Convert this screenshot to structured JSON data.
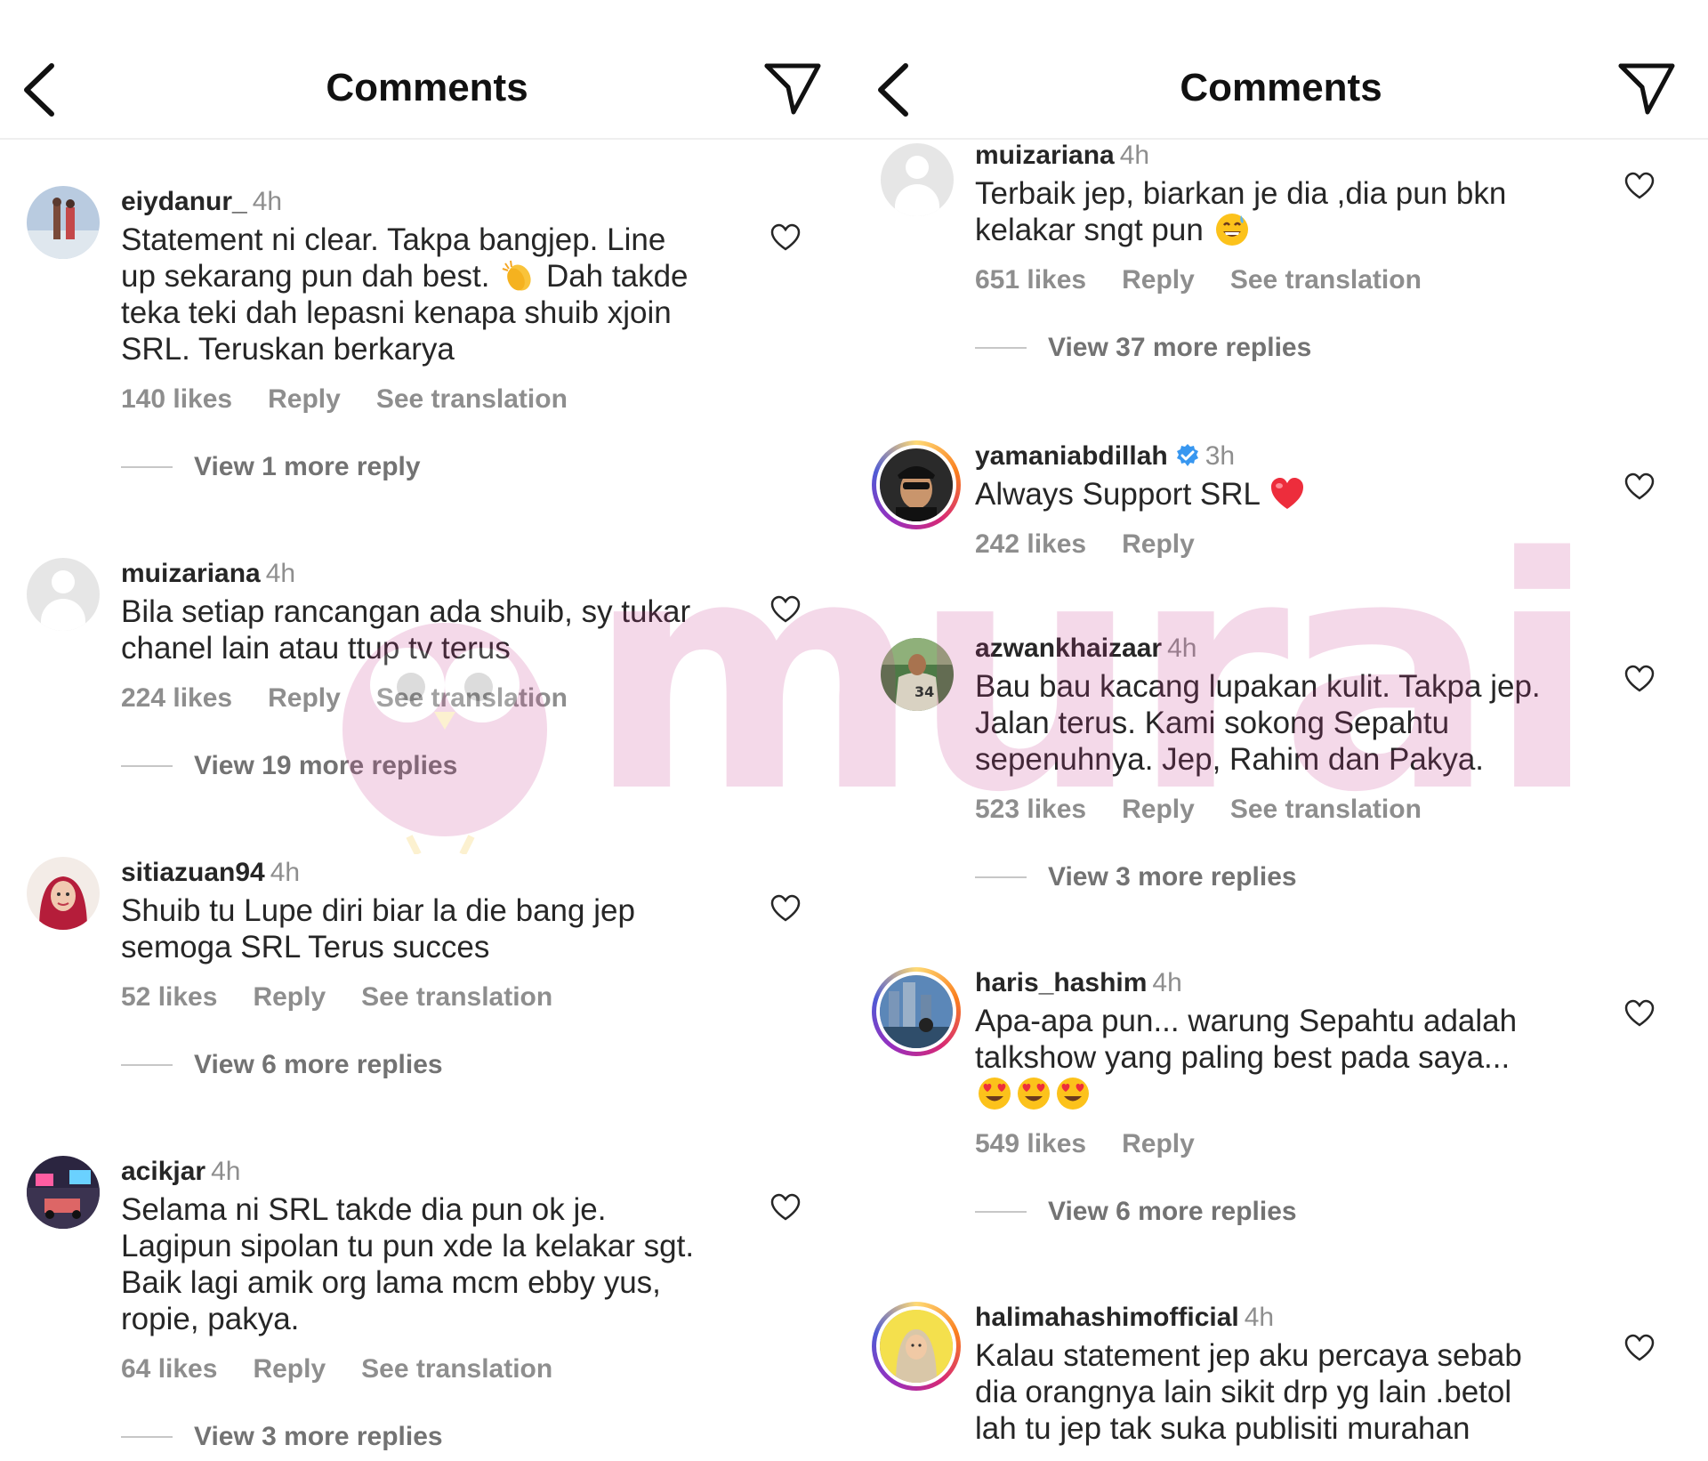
{
  "panels": [
    {
      "header": {
        "title": "Comments"
      },
      "comments": [
        {
          "user": "eiydanur_",
          "time": "4h",
          "text_parts": [
            "Statement ni clear. Takpa bangjep. Line\nup sekarang pun dah best. ",
            " Dah takde\nteka teki dah lepasni kenapa shuib xjoin\nSRL. Teruskan berkarya"
          ],
          "emoji": "clapping-hands",
          "likes": "140 likes",
          "reply": "Reply",
          "translation": "See translation",
          "replies": "View 1 more reply"
        },
        {
          "user": "muizariana",
          "time": "4h",
          "text": "Bila setiap rancangan ada shuib, sy tukar\nchanel lain atau ttup tv terus",
          "likes": "224 likes",
          "reply": "Reply",
          "translation": "See translation",
          "replies": "View 19 more replies"
        },
        {
          "user": "sitiazuan94",
          "time": "4h",
          "text": "Shuib tu Lupe diri biar la die bang jep\nsemoga SRL Terus succes",
          "likes": "52 likes",
          "reply": "Reply",
          "translation": "See translation",
          "replies": "View 6 more replies"
        },
        {
          "user": "acikjar",
          "time": "4h",
          "text": "Selama ni SRL takde dia pun ok je.\nLagipun sipolan tu pun xde la kelakar sgt.\nBaik lagi amik org lama mcm ebby yus,\nropie, pakya.",
          "likes": "64 likes",
          "reply": "Reply",
          "translation": "See translation",
          "replies": "View 3 more replies"
        }
      ]
    },
    {
      "header": {
        "title": "Comments"
      },
      "comments": [
        {
          "user": "muizariana",
          "time": "4h",
          "text": "Terbaik jep, biarkan je dia ,dia pun bkn\nkelakar sngt pun ",
          "emoji": "grinning-sweat",
          "likes": "651 likes",
          "reply": "Reply",
          "translation": "See translation",
          "replies": "View 37 more replies"
        },
        {
          "user": "yamaniabdillah",
          "time": "3h",
          "verified": true,
          "text": "Always Support SRL ",
          "emoji": "red-heart",
          "likes": "242 likes",
          "reply": "Reply"
        },
        {
          "user": "azwankhaizaar",
          "time": "4h",
          "text": "Bau bau kacang lupakan kulit. Takpa jep.\nJalan terus. Kami sokong Sepahtu\nsepenuhnya. Jep, Rahim dan Pakya.",
          "likes": "523 likes",
          "reply": "Reply",
          "translation": "See translation",
          "replies": "View 3 more replies"
        },
        {
          "user": "haris_hashim",
          "time": "4h",
          "text": "Apa-apa pun... warung Sepahtu adalah\ntalkshow yang paling best pada saya...",
          "emoji": "heart-eyes",
          "likes": "549 likes",
          "reply": "Reply",
          "replies": "View 6 more replies"
        },
        {
          "user": "halimahashimofficial",
          "time": "4h",
          "text": "Kalau statement jep aku percaya sebab\ndia orangnya lain sikit drp yg lain .betol\nlah tu jep tak suka publisiti murahan"
        }
      ]
    }
  ],
  "watermark": {
    "text": "murai"
  },
  "colors": {
    "text": "#262626",
    "secondary": "#8e8e8e",
    "verified": "#3897f0",
    "heart_red": "#ed2d3c"
  }
}
